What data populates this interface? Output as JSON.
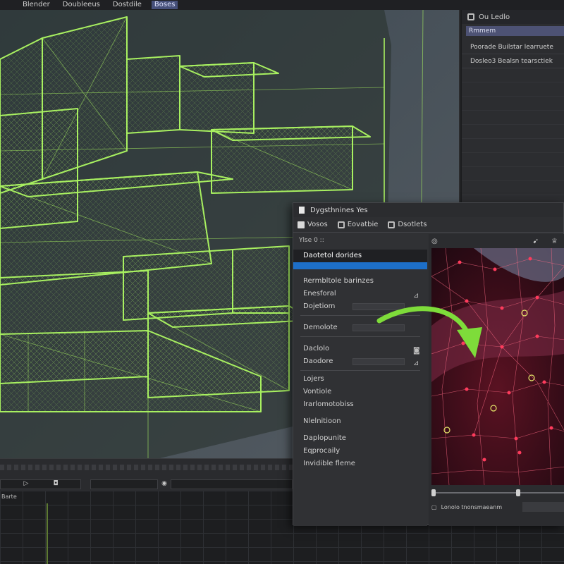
{
  "menubar": {
    "items": [
      "Blender",
      "Doubleeus",
      "Dostdile",
      "Boses"
    ],
    "active_index": 3
  },
  "outliner": {
    "header": "Ou Ledlo",
    "subheader": "Rmmem",
    "rows": [
      "Poorade  Builstar Iearruete",
      "Dosleo3  Bealsn tearsctiek"
    ]
  },
  "timeline": {
    "graph_label": "Barte"
  },
  "dialog": {
    "title": "Dygsthnines   Yes",
    "toolbar": {
      "tool1": "Vosos",
      "tool2": "Eovatbie",
      "tool3": "Dsotlets"
    },
    "mini_bar": "Ylse  0 ::",
    "props": {
      "selected": "Daotetol dorides",
      "item2": "Rermbltole barinzes",
      "item3": "Enesforal",
      "item4": "Dojetiom",
      "item5": "Demolote",
      "item6": "Daclolo",
      "item7": "Daodore"
    },
    "list": [
      "Lojers",
      "Vontiole",
      "Irarlomotobiss",
      "Nlelnitioon",
      "Daplopunite",
      "Eqprocaily",
      "Invidible fleme"
    ],
    "preview_icons": [
      "target-icon",
      "arrow-icon",
      "crown-icon"
    ],
    "status_text": "Lonolo tnonsmaeanm"
  },
  "colors": {
    "wire_green": "#a8f060",
    "selection_blue": "#1d6fc8",
    "accent_arrow": "#7edc3a",
    "mesh_red": "#ff3b5c"
  }
}
